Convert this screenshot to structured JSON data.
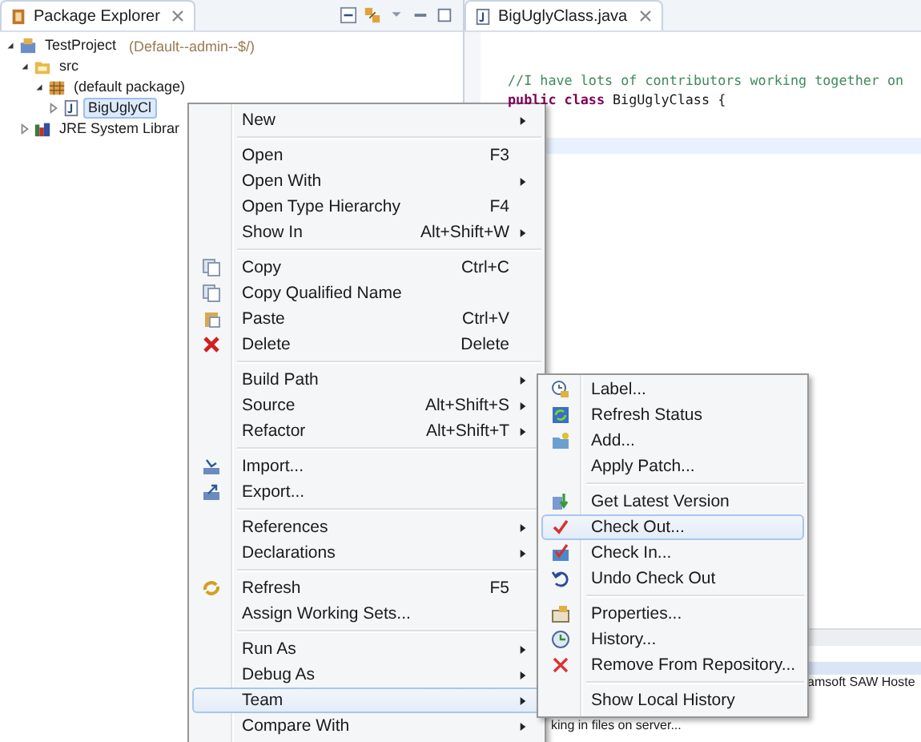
{
  "explorer": {
    "title": "Package Explorer",
    "tree": [
      {
        "label": "TestProject",
        "note": "(Default--admin--$/)",
        "kind": "project",
        "expanded": true,
        "selected": false,
        "children": [
          {
            "label": "src",
            "kind": "folder",
            "expanded": true,
            "selected": false,
            "children": [
              {
                "label": "(default package)",
                "kind": "package",
                "expanded": true,
                "selected": false,
                "children": [
                  {
                    "label": "BigUglyCl",
                    "kind": "java",
                    "expanded": false,
                    "selected": true
                  }
                ]
              }
            ]
          },
          {
            "label": "JRE System Librar",
            "kind": "library",
            "expanded": false,
            "selected": false
          }
        ]
      }
    ]
  },
  "editor": {
    "tab": "BigUglyClass.java",
    "lines": [
      {
        "kind": "comment",
        "text": "//I have lots of contributors working together on"
      },
      {
        "kind": "code",
        "keywords": "public class",
        "text": "BigUglyClass {"
      }
    ]
  },
  "console": {
    "lines": [
      "amsoft SAW Hoste",
      "king in files on server..."
    ]
  },
  "context_menu": {
    "groups": [
      [
        {
          "label": "New",
          "kind": "plain",
          "submenu": true,
          "selected": false
        }
      ],
      [
        {
          "label": "Open",
          "shortcut": "F3",
          "kind": "plain",
          "submenu": false,
          "selected": false
        },
        {
          "label": "Open With",
          "kind": "plain",
          "submenu": true,
          "selected": false
        },
        {
          "label": "Open Type Hierarchy",
          "shortcut": "F4",
          "kind": "plain",
          "submenu": false,
          "selected": false
        },
        {
          "label": "Show In",
          "shortcut": "Alt+Shift+W",
          "kind": "plain",
          "submenu": true,
          "selected": false
        }
      ],
      [
        {
          "label": "Copy",
          "shortcut": "Ctrl+C",
          "kind": "copy",
          "submenu": false,
          "selected": false
        },
        {
          "label": "Copy Qualified Name",
          "kind": "copy",
          "submenu": false,
          "selected": false
        },
        {
          "label": "Paste",
          "shortcut": "Ctrl+V",
          "kind": "paste",
          "submenu": false,
          "selected": false
        },
        {
          "label": "Delete",
          "shortcut": "Delete",
          "kind": "delete",
          "submenu": false,
          "selected": false
        }
      ],
      [
        {
          "label": "Build Path",
          "kind": "plain",
          "submenu": true,
          "selected": false
        },
        {
          "label": "Source",
          "shortcut": "Alt+Shift+S",
          "kind": "plain",
          "submenu": true,
          "selected": false
        },
        {
          "label": "Refactor",
          "shortcut": "Alt+Shift+T",
          "kind": "plain",
          "submenu": true,
          "selected": false
        }
      ],
      [
        {
          "label": "Import...",
          "kind": "import",
          "submenu": false,
          "selected": false
        },
        {
          "label": "Export...",
          "kind": "export",
          "submenu": false,
          "selected": false
        }
      ],
      [
        {
          "label": "References",
          "kind": "plain",
          "submenu": true,
          "selected": false
        },
        {
          "label": "Declarations",
          "kind": "plain",
          "submenu": true,
          "selected": false
        }
      ],
      [
        {
          "label": "Refresh",
          "shortcut": "F5",
          "kind": "refresh",
          "submenu": false,
          "selected": false
        },
        {
          "label": "Assign Working Sets...",
          "kind": "plain",
          "submenu": false,
          "selected": false
        }
      ],
      [
        {
          "label": "Run As",
          "kind": "plain",
          "submenu": true,
          "selected": false
        },
        {
          "label": "Debug As",
          "kind": "plain",
          "submenu": true,
          "selected": false
        },
        {
          "label": "Team",
          "kind": "plain",
          "submenu": true,
          "selected": true
        },
        {
          "label": "Compare With",
          "kind": "plain",
          "submenu": true,
          "selected": false
        }
      ]
    ]
  },
  "team_menu": {
    "groups": [
      [
        {
          "label": "Label...",
          "kind": "label",
          "selected": false
        },
        {
          "label": "Refresh Status",
          "kind": "status",
          "selected": false
        },
        {
          "label": "Add...",
          "kind": "add",
          "selected": false
        },
        {
          "label": "Apply Patch...",
          "kind": "plain",
          "selected": false
        }
      ],
      [
        {
          "label": "Get Latest Version",
          "kind": "latest",
          "selected": false
        },
        {
          "label": "Check Out...",
          "kind": "checkout",
          "selected": true
        },
        {
          "label": "Check In...",
          "kind": "checkin",
          "selected": false
        },
        {
          "label": "Undo Check Out",
          "kind": "undo",
          "selected": false
        }
      ],
      [
        {
          "label": "Properties...",
          "kind": "properties",
          "selected": false
        },
        {
          "label": "History...",
          "kind": "history",
          "selected": false
        },
        {
          "label": "Remove From Repository...",
          "kind": "remove",
          "selected": false
        }
      ],
      [
        {
          "label": "Show Local History",
          "kind": "plain",
          "selected": false
        }
      ]
    ]
  }
}
